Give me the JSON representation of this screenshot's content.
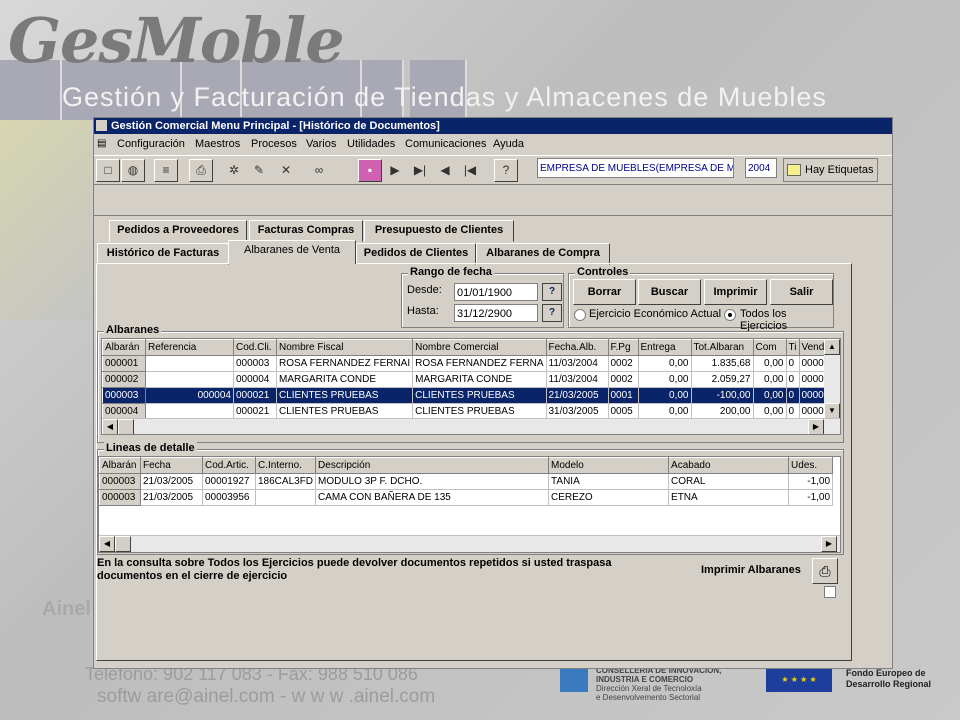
{
  "background": {
    "logo": "GesMoble",
    "tagline": "Gestión y Facturación de Tiendas y Almacenes de Muebles",
    "company": "Ainel",
    "phone": "Teléfono: 902 117 083 - Fax: 988 510 086",
    "web": "softw are@ainel.com - w w w .ainel.com",
    "xunta_text": [
      "CONSELLERÍA DE INNOVACIÓN,",
      "INDUSTRIA E COMERCIO",
      "Dirección Xeral de Tecnoloxía",
      "e Desenvolvemento Sectorial"
    ],
    "eu_text": [
      "Fondo Europeo de",
      "Desarrollo Regional"
    ]
  },
  "window": {
    "title": "Gestión Comercial  Menu Principal - [Histórico de Documentos]",
    "menu": [
      "Configuración",
      "Maestros",
      "Procesos",
      "Varios",
      "Utilidades",
      "Comunicaciones",
      "Ayuda"
    ],
    "toolbar_icons": [
      "new-icon",
      "globe-icon",
      "notes-icon",
      "print-icon",
      "gear-icon",
      "edit-icon",
      "delete-icon",
      "binoculars-icon",
      "bookmark-icon",
      "next-icon",
      "last-icon",
      "prev-icon",
      "first-icon",
      "help-icon"
    ],
    "empresa": "EMPRESA DE MUEBLES(EMPRESA DE MUE",
    "year": "2004",
    "etiquetas": "Hay Etiquetas"
  },
  "tabs_top": [
    "Pedidos a Proveedores",
    "Facturas Compras",
    "Presupuesto de Clientes"
  ],
  "tabs_bottom": [
    "Histórico de Facturas",
    "Albaranes de Venta",
    "Pedidos de Clientes",
    "Albaranes de Compra"
  ],
  "active_tab": "Albaranes de Venta",
  "rango": {
    "title": "Rango de fecha",
    "desde_label": "Desde:",
    "desde": "01/01/1900",
    "hasta_label": "Hasta:",
    "hasta": "31/12/2900",
    "lookup": "?"
  },
  "controles": {
    "title": "Controles",
    "buttons": [
      "Borrar",
      "Buscar",
      "Imprimir",
      "Salir"
    ],
    "radio1": "Ejercicio Económico Actual",
    "radio2": "Todos los Ejercicios",
    "selected": "Todos los Ejercicios"
  },
  "albaranes": {
    "title": "Albaranes",
    "columns": [
      "Albarán",
      "Referencia",
      "Cod.Cli.",
      "Nombre Fiscal",
      "Nombre Comercial",
      "Fecha.Alb.",
      "F.Pg",
      "Entrega",
      "Tot.Albaran",
      "Com",
      "Ti",
      "Vend."
    ],
    "rows": [
      [
        "000001",
        "",
        "000003",
        "ROSA FERNANDEZ FERNAI",
        "ROSA  FERNANDEZ FERNA",
        "11/03/2004",
        "0002",
        "0,00",
        "1.835,68",
        "0,00",
        "0",
        "00000"
      ],
      [
        "000002",
        "",
        "000004",
        "MARGARITA CONDE",
        "MARGARITA CONDE",
        "11/03/2004",
        "0002",
        "0,00",
        "2.059,27",
        "0,00",
        "0",
        "00000"
      ],
      [
        "000003",
        "000004",
        "000021",
        "CLIENTES PRUEBAS",
        "CLIENTES PRUEBAS",
        "21/03/2005",
        "0001",
        "0,00",
        "-100,00",
        "0,00",
        "0",
        "00000"
      ],
      [
        "000004",
        "",
        "000021",
        "CLIENTES PRUEBAS",
        "CLIENTES PRUEBAS",
        "31/03/2005",
        "0005",
        "0,00",
        "200,00",
        "0,00",
        "0",
        "00000"
      ]
    ],
    "selected_row": 2
  },
  "detalle": {
    "title": "Lineas de detalle",
    "columns": [
      "Albarán",
      "Fecha",
      "Cod.Artic.",
      "C.Interno.",
      "Descripción",
      "Modelo",
      "Acabado",
      "Udes."
    ],
    "rows": [
      [
        "000003",
        "21/03/2005",
        "00001927",
        "186CAL3FD",
        "MODULO 3P F. DCHO.",
        "TANIA",
        "CORAL",
        "-1,00"
      ],
      [
        "000003",
        "21/03/2005",
        "00003956",
        "",
        "CAMA CON BAÑERA DE 135",
        "CEREZO",
        "ETNA",
        "-1,00"
      ]
    ]
  },
  "note": "En la consulta sobre Todos los Ejercicios puede devolver documentos repetidos si usted traspasa documentos en el cierre de ejercicio",
  "print_label": "Imprimir Albaranes"
}
